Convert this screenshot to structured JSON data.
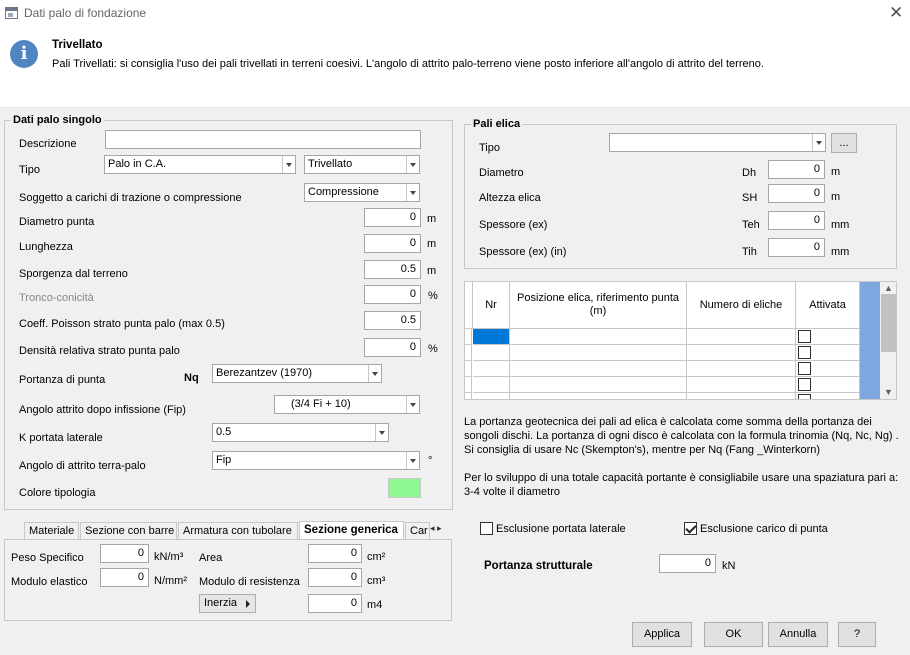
{
  "window": {
    "title": "Dati palo di fondazione",
    "close_glyph": "✕"
  },
  "info": {
    "heading": "Trivellato",
    "text": "Pali Trivellati: si consiglia l'uso dei pali trivellati in terreni coesivi. L'angolo di attrito palo-terreno viene posto inferiore all'angolo di attrito del terreno.",
    "icon_glyph": "i"
  },
  "single": {
    "title": "Dati palo singolo",
    "descrizione_label": "Descrizione",
    "descrizione_value": "",
    "tipo_label": "Tipo",
    "tipo_value": "Palo in C.A.",
    "tipo2_value": "Trivellato",
    "soggetto_label": "Soggetto a carichi di trazione o compressione",
    "soggetto_value": "Compressione",
    "diametro_label": "Diametro punta",
    "diametro_value": "0",
    "diametro_unit": "m",
    "lunghezza_label": "Lunghezza",
    "lunghezza_value": "0",
    "lunghezza_unit": "m",
    "sporgenza_label": "Sporgenza dal terreno",
    "sporgenza_value": "0.5",
    "sporgenza_unit": "m",
    "tronco_label": "Tronco-conicità",
    "tronco_value": "0",
    "tronco_unit": "%",
    "poisson_label": "Coeff. Poisson strato punta palo (max 0.5)",
    "poisson_value": "0.5",
    "densita_label": "Densità relativa strato punta palo",
    "densita_value": "0",
    "densita_unit": "%",
    "portanza_label": "Portanza di punta",
    "portanza_nq": "Nq",
    "portanza_value": "Berezantzev (1970)",
    "angolo_label": "Angolo attrito dopo infissione (Fip)",
    "angolo_value": "(3/4 Fi + 10)",
    "kportata_label": "K portata laterale",
    "kportata_value": "0.5",
    "angterra_label": "Angolo di attrito terra-palo",
    "angterra_value": "Fip",
    "angterra_unit": "°",
    "colore_label": "Colore tipologia",
    "colore_hex": "#90f890"
  },
  "tabs": {
    "items": [
      "Materiale",
      "Sezione con barre",
      "Armatura con tubolare",
      "Sezione generica",
      "Car"
    ],
    "active": "Sezione generica",
    "scroll_glyph": "◂ ▸"
  },
  "section": {
    "peso_label": "Peso Specifico",
    "peso_value": "0",
    "peso_unit": "kN/m³",
    "modulo_label": "Modulo elastico",
    "modulo_value": "0",
    "modulo_unit": "N/mm²",
    "area_label": "Area",
    "area_value": "0",
    "area_unit": "cm²",
    "resistenza_label": "Modulo di resistenza",
    "resistenza_value": "0",
    "resistenza_unit": "cm³",
    "inerzia_label": "Inerzia",
    "inerzia_value": "0",
    "inerzia_unit": "m4"
  },
  "elica": {
    "title": "Pali elica",
    "tipo_label": "Tipo",
    "tipo_value": "",
    "browse_label": "...",
    "diametro_label": "Diametro",
    "diametro_sym": "Dh",
    "diametro_value": "0",
    "diametro_unit": "m",
    "altezza_label": "Altezza elica",
    "altezza_sym": "SH",
    "altezza_value": "0",
    "altezza_unit": "m",
    "spessore_label": "Spessore (ex)",
    "spessore_sym": "Teh",
    "spessore_value": "0",
    "spessore_unit": "mm",
    "spessore_in_label": "Spessore (ex) (in)",
    "spessore_in_sym": "Tih",
    "spessore_in_value": "0",
    "spessore_in_unit": "mm"
  },
  "grid": {
    "columns": [
      "Nr",
      "Posizione elica, riferimento punta (m)",
      "Numero di eliche",
      "Attivata"
    ],
    "row_count": 5,
    "scroll_up": "▲",
    "scroll_down": "▼"
  },
  "notes": {
    "p1": "La portanza geotecnica dei pali ad elica è calcolata come somma della portanza dei songoli dischi. La portanza di ogni disco è calcolata con la formula trinomia (Nq, Nc, Ng) . Si consiglia di usare Nc (Skempton's), mentre per Nq (Fang _Winterkorn)",
    "p2": "Per lo sviluppo di una totale capacità portante è consigliabile usare una spaziatura pari a: 3-4 volte il diametro"
  },
  "options": {
    "escl_laterale_label": "Esclusione portata laterale",
    "escl_laterale_checked": false,
    "escl_punta_label": "Esclusione carico di punta",
    "escl_punta_checked": true,
    "strutturale_label": "Portanza strutturale",
    "strutturale_value": "0",
    "strutturale_unit": "kN"
  },
  "buttons": {
    "applica": "Applica",
    "ok": "OK",
    "annulla": "Annulla",
    "help": "?"
  }
}
